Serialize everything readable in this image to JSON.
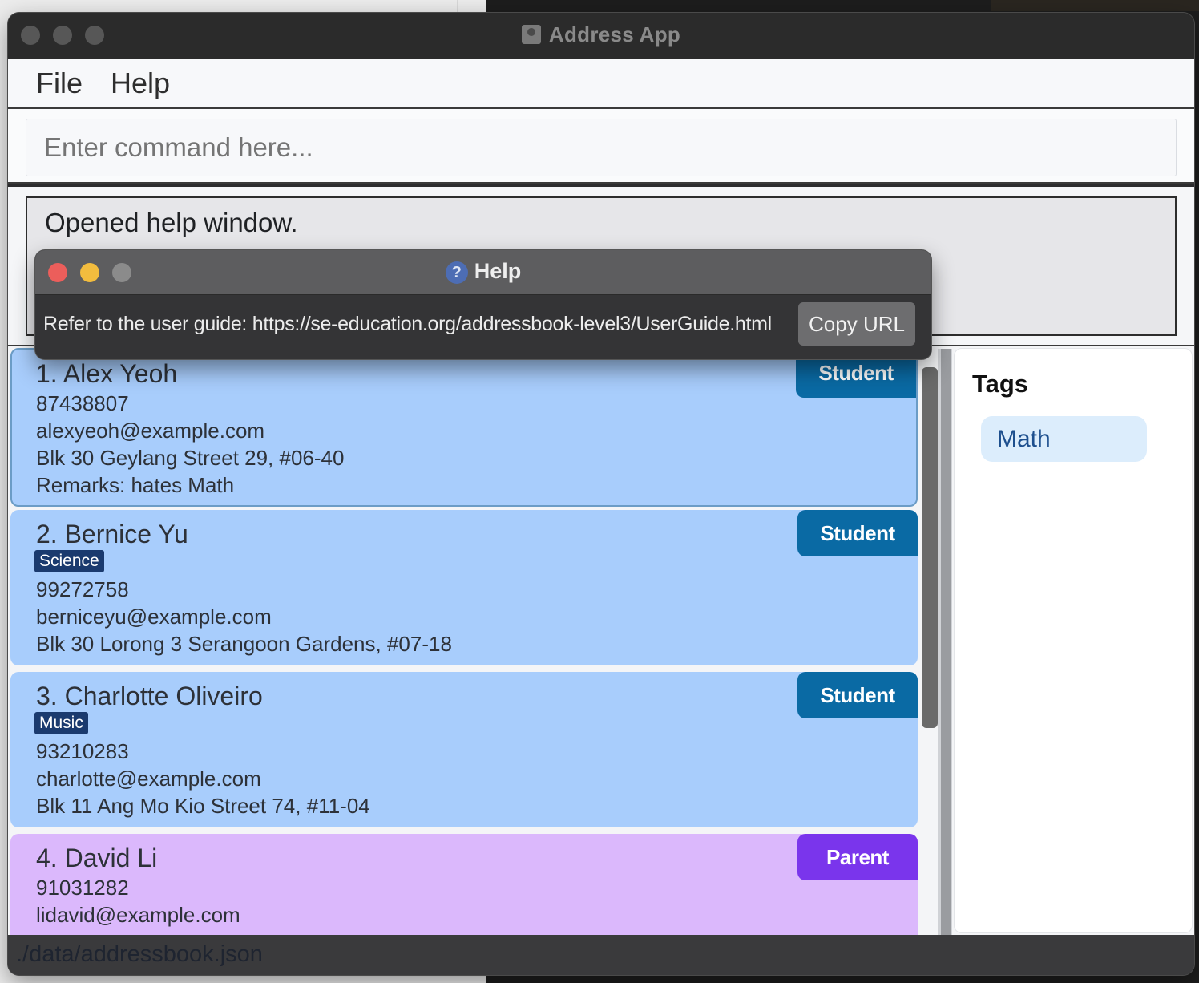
{
  "window": {
    "title": "Address App",
    "icon": "address-book-icon"
  },
  "menu": {
    "file": "File",
    "help": "Help"
  },
  "command": {
    "placeholder": "Enter command here..."
  },
  "result": {
    "text": "Opened help window."
  },
  "help_window": {
    "title": "Help",
    "icon": "question-icon",
    "message": "Refer to the user guide: https://se-education.org/addressbook-level3/UserGuide.html",
    "copy_button": "Copy URL"
  },
  "persons": [
    {
      "name": "1. Alex Yeoh",
      "role": "Student",
      "phone": "87438807",
      "email": "alexyeoh@example.com",
      "address": "Blk 30 Geylang Street 29, #06-40",
      "remarks": "Remarks: hates Math"
    },
    {
      "name": "2. Bernice Yu",
      "role": "Student",
      "tag": "Science",
      "phone": "99272758",
      "email": "berniceyu@example.com",
      "address": "Blk 30 Lorong 3 Serangoon Gardens, #07-18"
    },
    {
      "name": "3. Charlotte Oliveiro",
      "role": "Student",
      "tag": "Music",
      "phone": "93210283",
      "email": "charlotte@example.com",
      "address": "Blk 11 Ang Mo Kio Street 74, #11-04"
    },
    {
      "name": "4. David Li",
      "role": "Parent",
      "phone": "91031282",
      "email": "lidavid@example.com"
    }
  ],
  "tags_panel": {
    "title": "Tags",
    "tags": [
      "Math"
    ]
  },
  "status": {
    "path": "./data/addressbook.json"
  },
  "colors": {
    "student_badge": "#0a6aa4",
    "parent_badge": "#7a35ec",
    "student_card": "#a8cdfc",
    "parent_card": "#dbb8fc",
    "tag_chip": "#1a3a6e"
  }
}
